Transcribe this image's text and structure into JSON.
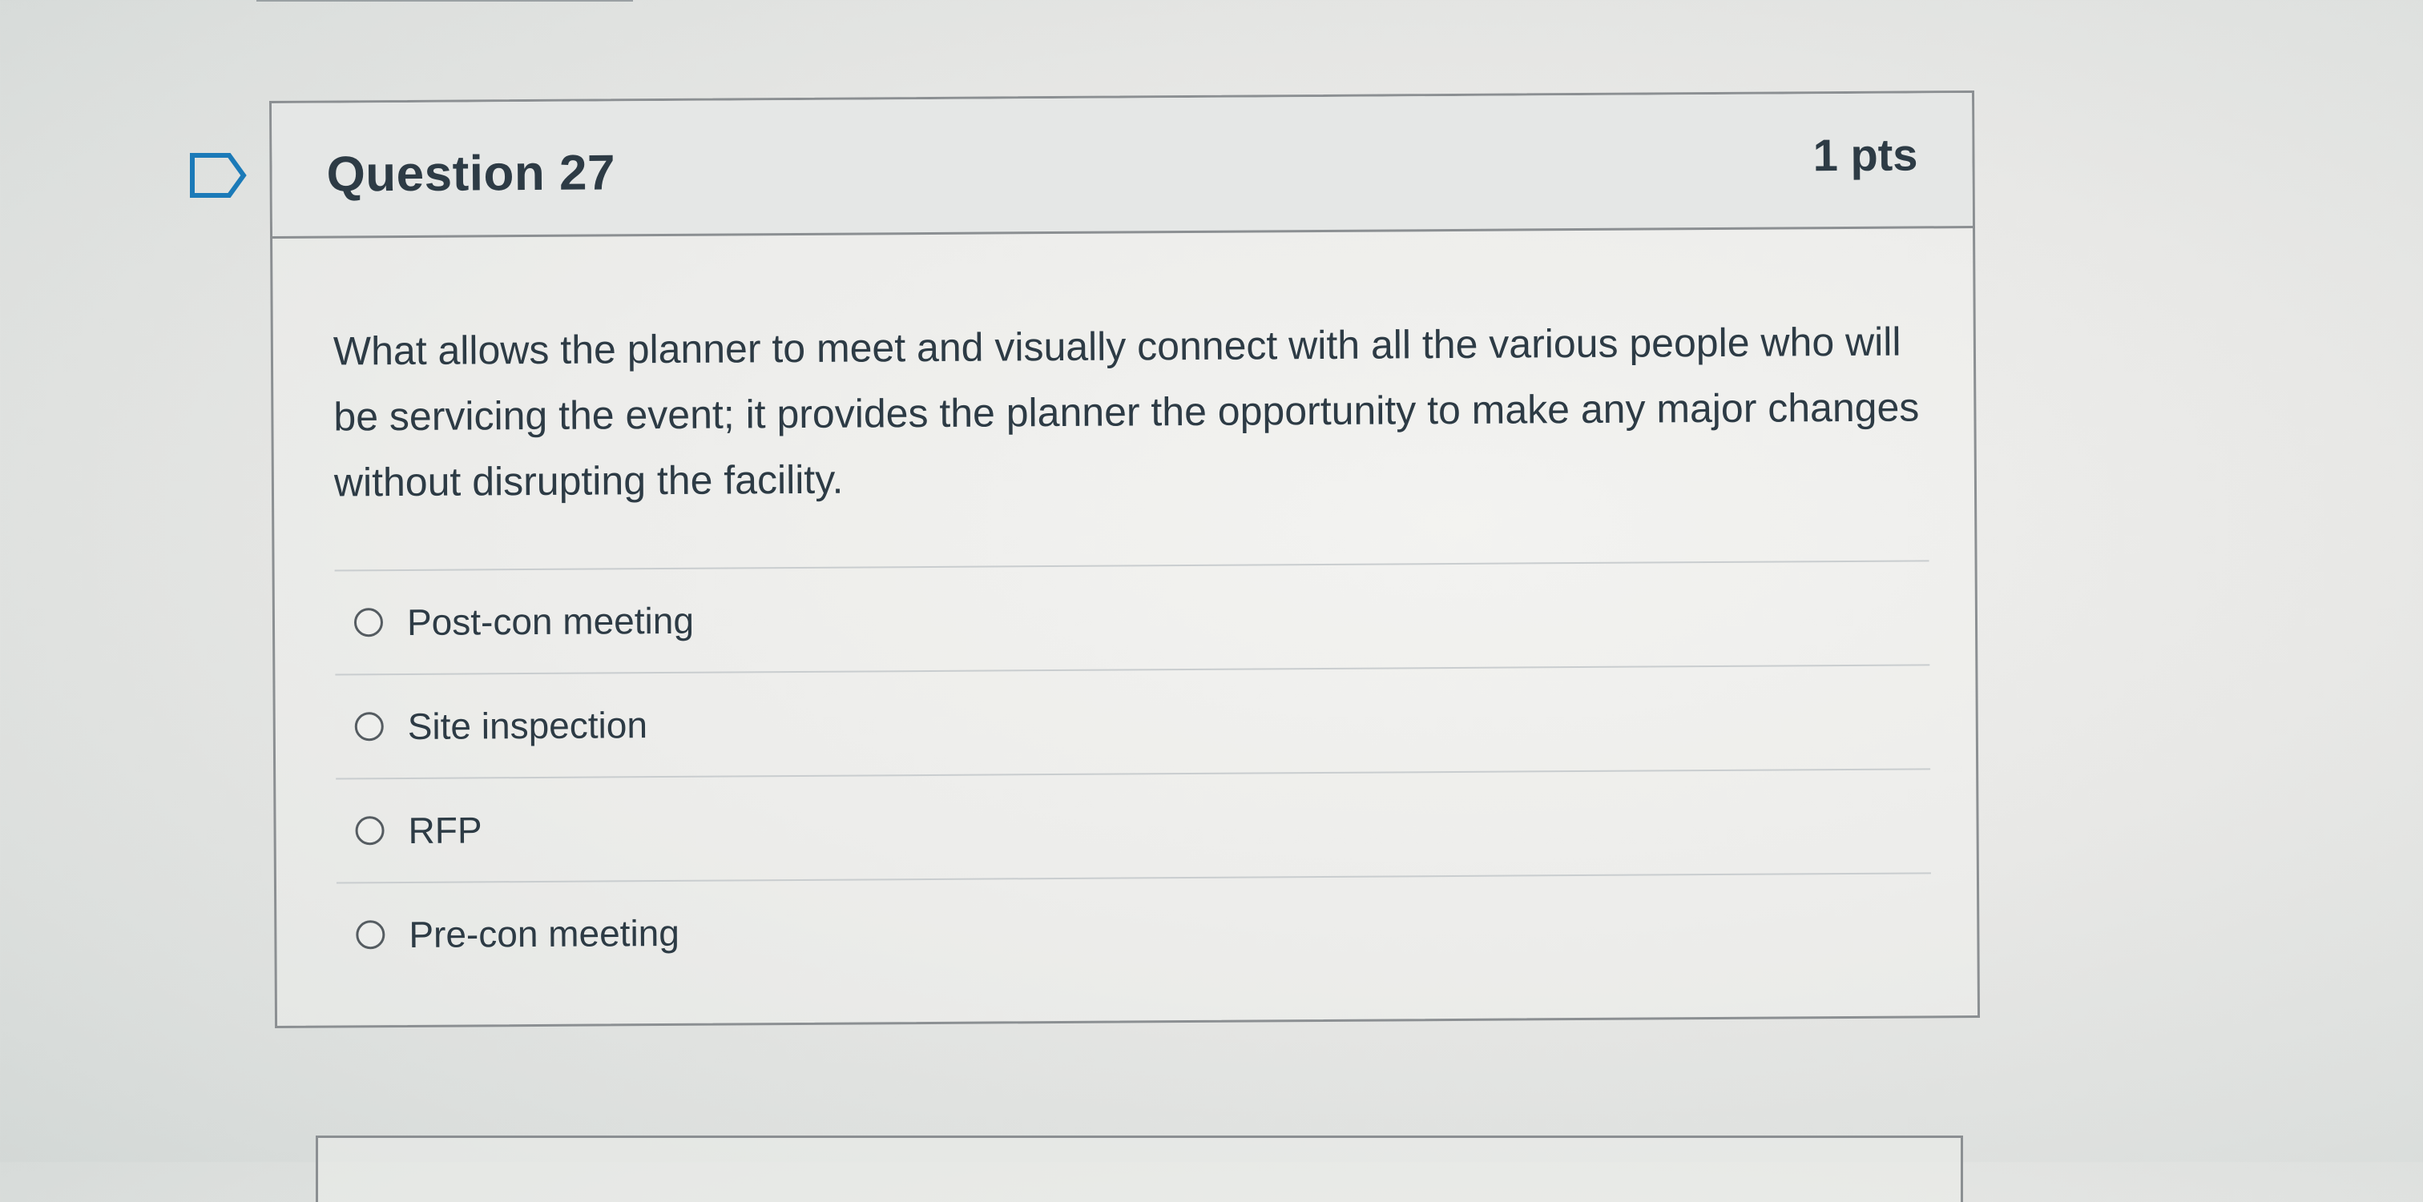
{
  "question": {
    "title": "Question 27",
    "points": "1 pts",
    "text": "What allows the planner to meet and visually connect with all the various people who will be servicing the event; it provides the planner the opportunity to make any major changes without disrupting the facility.",
    "answers": [
      {
        "label": "Post-con meeting",
        "selected": false
      },
      {
        "label": "Site inspection",
        "selected": false
      },
      {
        "label": "RFP",
        "selected": false
      },
      {
        "label": "Pre-con meeting",
        "selected": false
      }
    ]
  },
  "icons": {
    "bookmark": "flag-bookmark-icon",
    "radio": "radio-unselected-icon"
  },
  "colors": {
    "text": "#2d3b45",
    "border": "#8b8f92",
    "header_bg": "#e5e7e6",
    "bookmark": "#1b7ab8"
  }
}
